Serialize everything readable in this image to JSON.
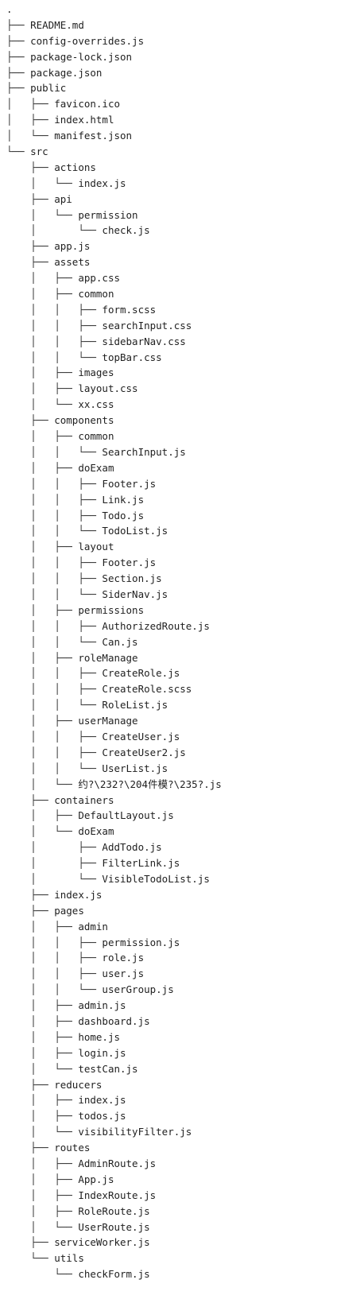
{
  "tree": {
    "lines": [
      {
        "prefix": "",
        "name": "."
      },
      {
        "prefix": "├── ",
        "name": "README.md"
      },
      {
        "prefix": "├── ",
        "name": "config-overrides.js"
      },
      {
        "prefix": "├── ",
        "name": "package-lock.json"
      },
      {
        "prefix": "├── ",
        "name": "package.json"
      },
      {
        "prefix": "├── ",
        "name": "public"
      },
      {
        "prefix": "│   ├── ",
        "name": "favicon.ico"
      },
      {
        "prefix": "│   ├── ",
        "name": "index.html"
      },
      {
        "prefix": "│   └── ",
        "name": "manifest.json"
      },
      {
        "prefix": "└── ",
        "name": "src"
      },
      {
        "prefix": "    ├── ",
        "name": "actions"
      },
      {
        "prefix": "    │   └── ",
        "name": "index.js"
      },
      {
        "prefix": "    ├── ",
        "name": "api"
      },
      {
        "prefix": "    │   └── ",
        "name": "permission"
      },
      {
        "prefix": "    │       └── ",
        "name": "check.js"
      },
      {
        "prefix": "    ├── ",
        "name": "app.js"
      },
      {
        "prefix": "    ├── ",
        "name": "assets"
      },
      {
        "prefix": "    │   ├── ",
        "name": "app.css"
      },
      {
        "prefix": "    │   ├── ",
        "name": "common"
      },
      {
        "prefix": "    │   │   ├── ",
        "name": "form.scss"
      },
      {
        "prefix": "    │   │   ├── ",
        "name": "searchInput.css"
      },
      {
        "prefix": "    │   │   ├── ",
        "name": "sidebarNav.css"
      },
      {
        "prefix": "    │   │   └── ",
        "name": "topBar.css"
      },
      {
        "prefix": "    │   ├── ",
        "name": "images"
      },
      {
        "prefix": "    │   ├── ",
        "name": "layout.css"
      },
      {
        "prefix": "    │   └── ",
        "name": "xx.css"
      },
      {
        "prefix": "    ├── ",
        "name": "components"
      },
      {
        "prefix": "    │   ├── ",
        "name": "common"
      },
      {
        "prefix": "    │   │   └── ",
        "name": "SearchInput.js"
      },
      {
        "prefix": "    │   ├── ",
        "name": "doExam"
      },
      {
        "prefix": "    │   │   ├── ",
        "name": "Footer.js"
      },
      {
        "prefix": "    │   │   ├── ",
        "name": "Link.js"
      },
      {
        "prefix": "    │   │   ├── ",
        "name": "Todo.js"
      },
      {
        "prefix": "    │   │   └── ",
        "name": "TodoList.js"
      },
      {
        "prefix": "    │   ├── ",
        "name": "layout"
      },
      {
        "prefix": "    │   │   ├── ",
        "name": "Footer.js"
      },
      {
        "prefix": "    │   │   ├── ",
        "name": "Section.js"
      },
      {
        "prefix": "    │   │   └── ",
        "name": "SiderNav.js"
      },
      {
        "prefix": "    │   ├── ",
        "name": "permissions"
      },
      {
        "prefix": "    │   │   ├── ",
        "name": "AuthorizedRoute.js"
      },
      {
        "prefix": "    │   │   └── ",
        "name": "Can.js"
      },
      {
        "prefix": "    │   ├── ",
        "name": "roleManage"
      },
      {
        "prefix": "    │   │   ├── ",
        "name": "CreateRole.js"
      },
      {
        "prefix": "    │   │   ├── ",
        "name": "CreateRole.scss"
      },
      {
        "prefix": "    │   │   └── ",
        "name": "RoleList.js"
      },
      {
        "prefix": "    │   ├── ",
        "name": "userManage"
      },
      {
        "prefix": "    │   │   ├── ",
        "name": "CreateUser.js"
      },
      {
        "prefix": "    │   │   ├── ",
        "name": "CreateUser2.js"
      },
      {
        "prefix": "    │   │   └── ",
        "name": "UserList.js"
      },
      {
        "prefix": "    │   └── ",
        "name": "约?\\232?\\204件模?\\235?.js"
      },
      {
        "prefix": "    ├── ",
        "name": "containers"
      },
      {
        "prefix": "    │   ├── ",
        "name": "DefaultLayout.js"
      },
      {
        "prefix": "    │   └── ",
        "name": "doExam"
      },
      {
        "prefix": "    │       ├── ",
        "name": "AddTodo.js"
      },
      {
        "prefix": "    │       ├── ",
        "name": "FilterLink.js"
      },
      {
        "prefix": "    │       └── ",
        "name": "VisibleTodoList.js"
      },
      {
        "prefix": "    ├── ",
        "name": "index.js"
      },
      {
        "prefix": "    ├── ",
        "name": "pages"
      },
      {
        "prefix": "    │   ├── ",
        "name": "admin"
      },
      {
        "prefix": "    │   │   ├── ",
        "name": "permission.js"
      },
      {
        "prefix": "    │   │   ├── ",
        "name": "role.js"
      },
      {
        "prefix": "    │   │   ├── ",
        "name": "user.js"
      },
      {
        "prefix": "    │   │   └── ",
        "name": "userGroup.js"
      },
      {
        "prefix": "    │   ├── ",
        "name": "admin.js"
      },
      {
        "prefix": "    │   ├── ",
        "name": "dashboard.js"
      },
      {
        "prefix": "    │   ├── ",
        "name": "home.js"
      },
      {
        "prefix": "    │   ├── ",
        "name": "login.js"
      },
      {
        "prefix": "    │   └── ",
        "name": "testCan.js"
      },
      {
        "prefix": "    ├── ",
        "name": "reducers"
      },
      {
        "prefix": "    │   ├── ",
        "name": "index.js"
      },
      {
        "prefix": "    │   ├── ",
        "name": "todos.js"
      },
      {
        "prefix": "    │   └── ",
        "name": "visibilityFilter.js"
      },
      {
        "prefix": "    ├── ",
        "name": "routes"
      },
      {
        "prefix": "    │   ├── ",
        "name": "AdminRoute.js"
      },
      {
        "prefix": "    │   ├── ",
        "name": "App.js"
      },
      {
        "prefix": "    │   ├── ",
        "name": "IndexRoute.js"
      },
      {
        "prefix": "    │   ├── ",
        "name": "RoleRoute.js"
      },
      {
        "prefix": "    │   └── ",
        "name": "UserRoute.js"
      },
      {
        "prefix": "    ├── ",
        "name": "serviceWorker.js"
      },
      {
        "prefix": "    └── ",
        "name": "utils"
      },
      {
        "prefix": "        └── ",
        "name": "checkForm.js"
      }
    ]
  }
}
